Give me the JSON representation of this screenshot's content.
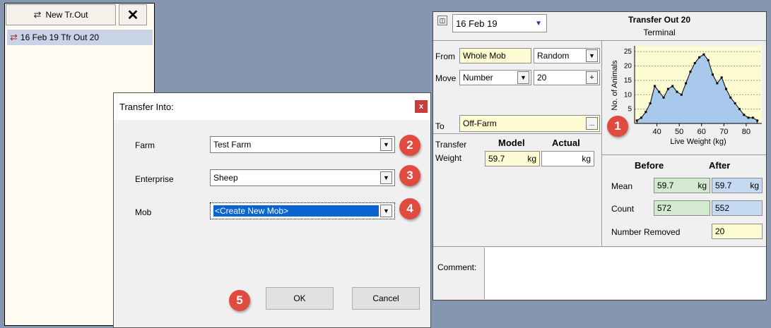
{
  "left_panel": {
    "new_button_label": "New Tr.Out",
    "close_label": "✕",
    "selected_item": "16 Feb 19 Tfr Out 20"
  },
  "transfer_panel": {
    "date": "16 Feb 19",
    "title": "Transfer Out 20",
    "subtitle": "Terminal",
    "from_label": "From",
    "from_value": "Whole Mob",
    "from_method": "Random",
    "move_label": "Move",
    "move_mode": "Number",
    "move_value": "20",
    "plus_label": "+",
    "to_label": "To",
    "to_value": "Off-Farm",
    "to_button_label": "...",
    "transfer_label": "Transfer",
    "weight_label": "Weight",
    "model_header": "Model",
    "actual_header": "Actual",
    "model_weight": "59.7",
    "unit": "kg",
    "before_header": "Before",
    "after_header": "After",
    "mean_label": "Mean",
    "mean_before": "59.7",
    "mean_after": "59.7",
    "count_label": "Count",
    "count_before": "572",
    "count_after": "552",
    "removed_label": "Number Removed",
    "removed_value": "20",
    "comment_label": "Comment:"
  },
  "dialog": {
    "title": "Transfer Into:",
    "close_label": "x",
    "farm_label": "Farm",
    "farm_value": "Test Farm",
    "enterprise_label": "Enterprise",
    "enterprise_value": "Sheep",
    "mob_label": "Mob",
    "mob_value": "<Create New Mob>",
    "ok_label": "OK",
    "cancel_label": "Cancel"
  },
  "badges": [
    "1",
    "2",
    "3",
    "4",
    "5"
  ],
  "chart_data": {
    "type": "area",
    "xlabel": "Live Weight (kg)",
    "ylabel": "No. of Animals",
    "xlim": [
      30,
      87
    ],
    "ylim": [
      0,
      27
    ],
    "xticks": [
      "40",
      "50",
      "60",
      "70",
      "80"
    ],
    "yticks": [
      "5",
      "10",
      "15",
      "20",
      "25"
    ],
    "x": [
      31,
      33,
      35,
      37,
      39,
      41,
      43,
      45,
      47,
      49,
      51,
      53,
      55,
      57,
      59,
      61,
      63,
      65,
      67,
      69,
      71,
      73,
      75,
      77,
      79,
      81,
      83,
      85
    ],
    "values": [
      1,
      2,
      4,
      7,
      13,
      11,
      9,
      12,
      13,
      11,
      10,
      14,
      18,
      21,
      23,
      24,
      22,
      17,
      14,
      16,
      12,
      9,
      7,
      5,
      3,
      2,
      2,
      1
    ],
    "fill": "#a8c8ec",
    "background": "#fdfbd2"
  },
  "colors": {
    "desktop": "#8596b0",
    "field_yellow": "#fdfbd2",
    "field_green": "#d4ead0",
    "field_blue": "#c4d9f2",
    "badge_red": "#e14a3f",
    "selection_blue": "#0a64d2"
  }
}
